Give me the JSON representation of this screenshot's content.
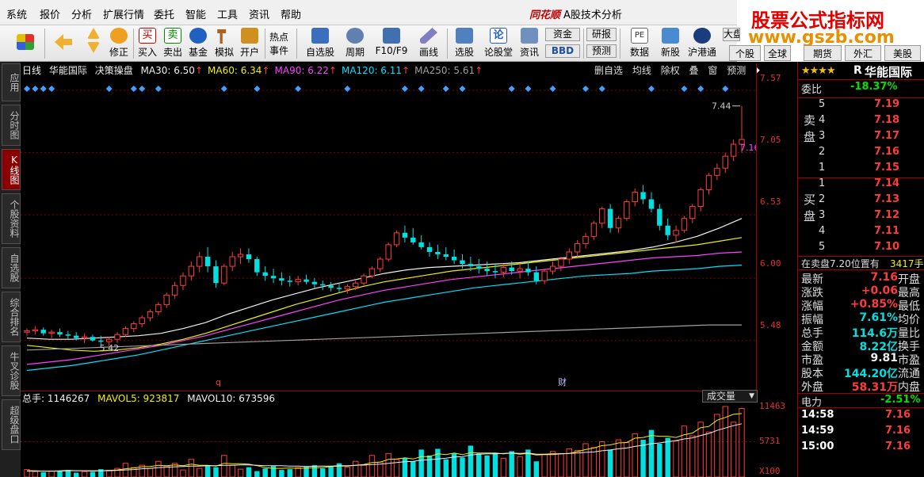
{
  "menu": [
    "系统",
    "报价",
    "分析",
    "扩展行情",
    "委托",
    "智能",
    "工具",
    "资讯",
    "帮助"
  ],
  "app_title": {
    "logo": "同花顺",
    "text": "A股技术分析"
  },
  "banner": {
    "title": "股票公式指标网",
    "url": "www.gszb.com"
  },
  "toolbar": {
    "buttons": [
      "修正",
      "买入",
      "卖出",
      "基金",
      "模拟",
      "开户",
      "热点",
      "事件",
      "自选股",
      "周期",
      "F10/F9",
      "画线",
      "选股",
      "论股堂",
      "资讯"
    ],
    "small": [
      "资金",
      "BBD",
      "研报",
      "预测",
      "数据",
      "新股",
      "沪港通",
      "大盘"
    ],
    "right_tabs": [
      "个股",
      "全球",
      "期货",
      "外汇",
      "美股"
    ]
  },
  "left_tabs": [
    "应用",
    "分时图",
    "K线图",
    "个股资料",
    "自选股",
    "综合排名",
    "牛叉诊股",
    "超级盘口"
  ],
  "chart_header": {
    "period": "日线",
    "stock": "华能国际",
    "indicator": "决策操盘",
    "ma": [
      {
        "label": "MA30: 6.50",
        "color": "#f0f0f0"
      },
      {
        "label": "MA60: 6.34",
        "color": "#f0f000"
      },
      {
        "label": "MA90: 6.22",
        "color": "#ff40ff"
      },
      {
        "label": "MA120: 6.11",
        "color": "#00e0ff"
      },
      {
        "label": "MA250: 5.61",
        "color": "#a0a0a0"
      }
    ],
    "arrow": "↑"
  },
  "chart_tools": [
    "删自选",
    "均线",
    "除权",
    "叠",
    "窗",
    "预测"
  ],
  "price_axis": [
    "7.57",
    "7.05",
    "6.53",
    "6.00",
    "5.48"
  ],
  "annotations": {
    "high": "7.44",
    "last": "7.16",
    "low": "5.42",
    "marker_q": "q",
    "marker_cai": "财"
  },
  "volume_header": {
    "total": "总手: 1146267",
    "mavol5": "MAVOL5: 923817",
    "mavol10": "MAVOL10: 673596",
    "select": "成交量"
  },
  "volume_axis": [
    "11463",
    "5731",
    "X100"
  ],
  "chart_data": {
    "type": "candlestick",
    "price_range": [
      5.2,
      7.65
    ],
    "candles": [
      [
        5.55,
        5.58,
        5.52,
        5.56
      ],
      [
        5.56,
        5.6,
        5.53,
        5.57
      ],
      [
        5.57,
        5.59,
        5.52,
        5.54
      ],
      [
        5.54,
        5.57,
        5.5,
        5.55
      ],
      [
        5.55,
        5.58,
        5.51,
        5.53
      ],
      [
        5.53,
        5.56,
        5.49,
        5.52
      ],
      [
        5.52,
        5.55,
        5.48,
        5.5
      ],
      [
        5.5,
        5.54,
        5.46,
        5.51
      ],
      [
        5.51,
        5.53,
        5.47,
        5.48
      ],
      [
        5.48,
        5.52,
        5.44,
        5.47
      ],
      [
        5.47,
        5.51,
        5.42,
        5.49
      ],
      [
        5.49,
        5.55,
        5.46,
        5.53
      ],
      [
        5.53,
        5.6,
        5.51,
        5.58
      ],
      [
        5.58,
        5.64,
        5.55,
        5.62
      ],
      [
        5.62,
        5.69,
        5.59,
        5.67
      ],
      [
        5.67,
        5.74,
        5.64,
        5.72
      ],
      [
        5.72,
        5.8,
        5.69,
        5.78
      ],
      [
        5.78,
        5.88,
        5.75,
        5.86
      ],
      [
        5.86,
        5.97,
        5.83,
        5.94
      ],
      [
        5.94,
        6.05,
        5.9,
        6.02
      ],
      [
        6.02,
        6.14,
        5.98,
        6.1
      ],
      [
        6.1,
        6.22,
        6.05,
        6.18
      ],
      [
        6.18,
        6.26,
        6.05,
        6.1
      ],
      [
        6.1,
        6.15,
        5.92,
        5.96
      ],
      [
        5.96,
        6.12,
        5.94,
        6.1
      ],
      [
        6.1,
        6.22,
        6.06,
        6.18
      ],
      [
        6.18,
        6.25,
        6.12,
        6.2
      ],
      [
        6.2,
        6.25,
        6.13,
        6.16
      ],
      [
        6.16,
        6.18,
        6.02,
        6.05
      ],
      [
        6.05,
        6.1,
        5.98,
        6.02
      ],
      [
        6.02,
        6.08,
        5.96,
        6.0
      ],
      [
        6.0,
        6.05,
        5.94,
        5.98
      ],
      [
        5.98,
        6.02,
        5.93,
        5.97
      ],
      [
        5.97,
        6.02,
        5.94,
        5.99
      ],
      [
        5.99,
        6.03,
        5.95,
        5.97
      ],
      [
        5.97,
        6.0,
        5.92,
        5.95
      ],
      [
        5.95,
        5.98,
        5.9,
        5.94
      ],
      [
        5.94,
        5.97,
        5.89,
        5.92
      ],
      [
        5.92,
        5.96,
        5.88,
        5.91
      ],
      [
        5.91,
        5.95,
        5.87,
        5.93
      ],
      [
        5.93,
        5.98,
        5.9,
        5.96
      ],
      [
        5.96,
        6.04,
        5.94,
        6.02
      ],
      [
        6.02,
        6.1,
        6.0,
        6.08
      ],
      [
        6.08,
        6.18,
        6.05,
        6.16
      ],
      [
        6.16,
        6.3,
        6.14,
        6.28
      ],
      [
        6.28,
        6.4,
        6.26,
        6.38
      ],
      [
        6.38,
        6.44,
        6.3,
        6.34
      ],
      [
        6.34,
        6.42,
        6.28,
        6.3
      ],
      [
        6.3,
        6.36,
        6.24,
        6.26
      ],
      [
        6.26,
        6.3,
        6.18,
        6.22
      ],
      [
        6.22,
        6.28,
        6.16,
        6.2
      ],
      [
        6.2,
        6.26,
        6.15,
        6.18
      ],
      [
        6.18,
        6.24,
        6.12,
        6.15
      ],
      [
        6.15,
        6.2,
        6.08,
        6.12
      ],
      [
        6.12,
        6.18,
        6.06,
        6.1
      ],
      [
        6.1,
        6.16,
        6.04,
        6.08
      ],
      [
        6.08,
        6.14,
        6.02,
        6.06
      ],
      [
        6.06,
        6.12,
        6.0,
        6.05
      ],
      [
        6.05,
        6.12,
        6.01,
        6.09
      ],
      [
        6.09,
        6.14,
        6.03,
        6.06
      ],
      [
        6.06,
        6.12,
        6.0,
        6.08
      ],
      [
        6.08,
        6.14,
        6.02,
        6.05
      ],
      [
        6.05,
        6.1,
        5.95,
        5.98
      ],
      [
        5.98,
        6.08,
        5.95,
        6.06
      ],
      [
        6.06,
        6.14,
        6.03,
        6.1
      ],
      [
        6.1,
        6.18,
        6.06,
        6.16
      ],
      [
        6.16,
        6.25,
        6.12,
        6.22
      ],
      [
        6.22,
        6.32,
        6.18,
        6.29
      ],
      [
        6.29,
        6.38,
        6.25,
        6.35
      ],
      [
        6.35,
        6.48,
        6.32,
        6.46
      ],
      [
        6.46,
        6.6,
        6.42,
        6.58
      ],
      [
        6.58,
        6.62,
        6.38,
        6.42
      ],
      [
        6.42,
        6.52,
        6.38,
        6.5
      ],
      [
        6.5,
        6.66,
        6.48,
        6.64
      ],
      [
        6.64,
        6.75,
        6.6,
        6.72
      ],
      [
        6.72,
        6.78,
        6.62,
        6.66
      ],
      [
        6.66,
        6.72,
        6.55,
        6.58
      ],
      [
        6.58,
        6.62,
        6.4,
        6.44
      ],
      [
        6.44,
        6.5,
        6.32,
        6.36
      ],
      [
        6.36,
        6.44,
        6.3,
        6.4
      ],
      [
        6.4,
        6.52,
        6.38,
        6.5
      ],
      [
        6.5,
        6.62,
        6.46,
        6.6
      ],
      [
        6.6,
        6.76,
        6.56,
        6.74
      ],
      [
        6.74,
        6.88,
        6.7,
        6.86
      ],
      [
        6.86,
        6.96,
        6.82,
        6.92
      ],
      [
        6.92,
        7.05,
        6.88,
        7.02
      ],
      [
        7.02,
        7.16,
        6.98,
        7.12
      ],
      [
        7.12,
        7.44,
        7.05,
        7.16
      ]
    ],
    "ma_series": [
      {
        "name": "MA30",
        "color": "#f0f0f0",
        "values": [
          5.5,
          5.49,
          5.49,
          5.5,
          5.51,
          5.52,
          5.54,
          5.58,
          5.63,
          5.7,
          5.76,
          5.82,
          5.87,
          5.92,
          5.96,
          6.0,
          6.04,
          6.07,
          6.09,
          6.1,
          6.11,
          6.12,
          6.13,
          6.15,
          6.17,
          6.19,
          6.21,
          6.23,
          6.26,
          6.3,
          6.35,
          6.42,
          6.5
        ]
      },
      {
        "name": "MA60",
        "color": "#f0f000",
        "values": [
          5.44,
          5.42,
          5.4,
          5.39,
          5.4,
          5.42,
          5.45,
          5.49,
          5.54,
          5.6,
          5.66,
          5.72,
          5.78,
          5.83,
          5.88,
          5.93,
          5.97,
          6.0,
          6.03,
          6.06,
          6.08,
          6.1,
          6.12,
          6.14,
          6.16,
          6.18,
          6.2,
          6.22,
          6.24,
          6.26,
          6.28,
          6.31,
          6.34
        ]
      },
      {
        "name": "MA90",
        "color": "#ff40ff",
        "values": [
          5.28,
          5.3,
          5.32,
          5.35,
          5.38,
          5.41,
          5.44,
          5.48,
          5.52,
          5.57,
          5.62,
          5.67,
          5.72,
          5.77,
          5.82,
          5.86,
          5.9,
          5.93,
          5.96,
          5.99,
          6.01,
          6.03,
          6.05,
          6.07,
          6.09,
          6.11,
          6.13,
          6.15,
          6.17,
          6.18,
          6.19,
          6.21,
          6.22
        ]
      },
      {
        "name": "MA120",
        "color": "#00e0ff",
        "values": [
          5.23,
          5.25,
          5.27,
          5.3,
          5.33,
          5.36,
          5.4,
          5.44,
          5.48,
          5.52,
          5.56,
          5.6,
          5.64,
          5.68,
          5.72,
          5.76,
          5.8,
          5.83,
          5.86,
          5.89,
          5.92,
          5.94,
          5.96,
          5.98,
          6.0,
          6.02,
          6.03,
          6.04,
          6.06,
          6.07,
          6.08,
          6.1,
          6.11
        ]
      },
      {
        "name": "MA250",
        "color": "#a0a0a0",
        "values": [
          5.4,
          5.41,
          5.42,
          5.43,
          5.44,
          5.45,
          5.46,
          5.47,
          5.48,
          5.49,
          5.5,
          5.51,
          5.52,
          5.53,
          5.54,
          5.55,
          5.56,
          5.57,
          5.58,
          5.59,
          5.6,
          5.61,
          5.61
        ]
      }
    ],
    "signal_diamonds": [
      0,
      1,
      2,
      3,
      10,
      13,
      14,
      16,
      24,
      28,
      33,
      39,
      46,
      48,
      51,
      53,
      59,
      61,
      64,
      68,
      70,
      76,
      80,
      82,
      85
    ],
    "volume": [
      19,
      14,
      12,
      15,
      16,
      18,
      11,
      14,
      13,
      20,
      17,
      22,
      35,
      24,
      30,
      22,
      40,
      28,
      35,
      18,
      45,
      22,
      30,
      25,
      55,
      30,
      20,
      25,
      15,
      22,
      28,
      18,
      20,
      24,
      26,
      30,
      22,
      28,
      35,
      25,
      40,
      30,
      55,
      38,
      60,
      45,
      48,
      40,
      70,
      55,
      72,
      45,
      60,
      50,
      80,
      60,
      55,
      62,
      48,
      66,
      52,
      70,
      40,
      58,
      65,
      60,
      72,
      68,
      85,
      75,
      90,
      70,
      95,
      88,
      110,
      95,
      120,
      85,
      100,
      92,
      130,
      105,
      140,
      115,
      160,
      180,
      140,
      175
    ],
    "mavol5": [
      16,
      16,
      15,
      15,
      16,
      17,
      16,
      16,
      15,
      16,
      17,
      18,
      21,
      23,
      26,
      27,
      30,
      29,
      31,
      29,
      33,
      30,
      30,
      28,
      35,
      34,
      34,
      33,
      29,
      24,
      22,
      22,
      23,
      22,
      23,
      24,
      24,
      27,
      28,
      28,
      30,
      32,
      37,
      38,
      45,
      46,
      49,
      46,
      52,
      52,
      59,
      57,
      61,
      57,
      62,
      61,
      61,
      61,
      59,
      61,
      58,
      60,
      56,
      57,
      57,
      59,
      60,
      65,
      70,
      74,
      80,
      82,
      87,
      88,
      99,
      101,
      106,
      104,
      104,
      101,
      108,
      112,
      126,
      129,
      145,
      152,
      160,
      162
    ],
    "mavol10": [
      15,
      15,
      15,
      15,
      15,
      16,
      16,
      16,
      16,
      16,
      16,
      17,
      18,
      19,
      21,
      22,
      24,
      25,
      26,
      27,
      28,
      28,
      29,
      29,
      30,
      30,
      31,
      31,
      30,
      29,
      29,
      29,
      28,
      28,
      27,
      28,
      28,
      28,
      29,
      29,
      30,
      31,
      32,
      33,
      35,
      37,
      39,
      40,
      43,
      44,
      46,
      48,
      51,
      52,
      56,
      58,
      59,
      59,
      60,
      61,
      60,
      61,
      58,
      58,
      59,
      59,
      60,
      61,
      63,
      64,
      67,
      69,
      72,
      74,
      78,
      81,
      85,
      87,
      90,
      93,
      97,
      100,
      106,
      111,
      119,
      125,
      131,
      136
    ]
  },
  "right_panel": {
    "stars": "★★★★",
    "r_mark": "R",
    "name": "华能国际",
    "weibi_label": "委比",
    "weibi": "-18.37%",
    "sell_label": "卖盘",
    "buy_label": "买盘",
    "sell": [
      {
        "lvl": "5",
        "price": "7.19"
      },
      {
        "lvl": "4",
        "price": "7.18"
      },
      {
        "lvl": "3",
        "price": "7.17"
      },
      {
        "lvl": "2",
        "price": "7.16"
      },
      {
        "lvl": "1",
        "price": "7.15"
      }
    ],
    "buy": [
      {
        "lvl": "1",
        "price": "7.14"
      },
      {
        "lvl": "2",
        "price": "7.13"
      },
      {
        "lvl": "3",
        "price": "7.12"
      },
      {
        "lvl": "4",
        "price": "7.11"
      },
      {
        "lvl": "5",
        "price": "7.10"
      }
    ],
    "sell_note": "在卖盘7.20位置有",
    "sell_note_val": "3417手",
    "stats": [
      {
        "k": "最新",
        "v": "7.16",
        "c": "red",
        "k2": "开盘"
      },
      {
        "k": "涨跌",
        "v": "+0.06",
        "c": "red",
        "k2": "最高"
      },
      {
        "k": "涨幅",
        "v": "+0.85%",
        "c": "red",
        "k2": "最低"
      },
      {
        "k": "振幅",
        "v": "7.61%",
        "c": "cyan",
        "k2": "均价"
      },
      {
        "k": "总手",
        "v": "114.6万",
        "c": "cyan",
        "k2": "量比"
      },
      {
        "k": "金额",
        "v": "8.22亿",
        "c": "cyan",
        "k2": "换手"
      },
      {
        "k": "市盈",
        "v": "9.81",
        "c": "white",
        "k2": "市盈"
      },
      {
        "k": "股本",
        "v": "144.20亿",
        "c": "cyan",
        "k2": "流通"
      },
      {
        "k": "外盘",
        "v": "58.31万",
        "c": "red",
        "k2": "内盘"
      }
    ],
    "sector": "电力",
    "sector_change": "-2.51%",
    "ticks": [
      {
        "t": "14:58",
        "p": "7.16"
      },
      {
        "t": "14:59",
        "p": "7.16"
      },
      {
        "t": "15:00",
        "p": "7.16"
      }
    ]
  },
  "colors": {
    "up": "#ff3c3c",
    "down": "#00e0e0",
    "grid": "#800000"
  }
}
